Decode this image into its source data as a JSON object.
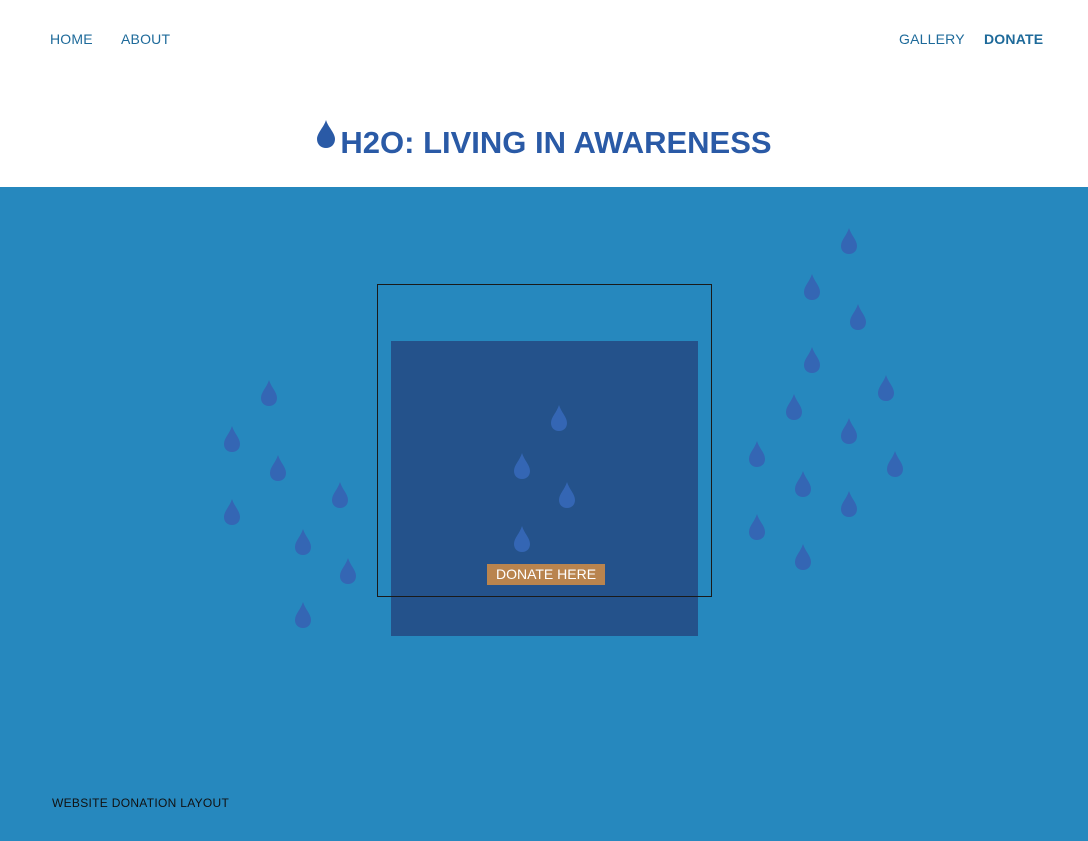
{
  "nav": {
    "home": "HOME",
    "about": "ABOUT",
    "gallery": "GALLERY",
    "donate": "DONATE"
  },
  "header": {
    "title": "H2O: LIVING IN AWARENESS",
    "title_icon": "water-drop-icon"
  },
  "hero": {
    "cta_label": "DONATE HERE",
    "decoration_icon": "water-drop-icon"
  },
  "footer": {
    "caption": "WEBSITE DONATION LAYOUT"
  },
  "colors": {
    "nav_text": "#1e6a9a",
    "title_text": "#2a5aa6",
    "hero_background": "#2688be",
    "panel": "#24528b",
    "drop": "#3466b4",
    "cta_background": "#b9844e"
  }
}
